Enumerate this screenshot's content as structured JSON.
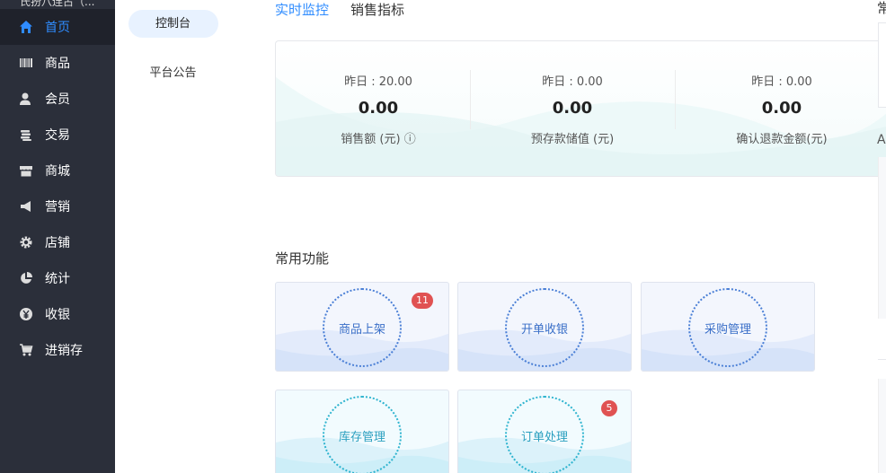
{
  "sidebar": {
    "store_name": "氏扮八连占（...",
    "items": [
      {
        "label": "首页",
        "icon": "home-icon",
        "active": true
      },
      {
        "label": "商品",
        "icon": "barcode-icon"
      },
      {
        "label": "会员",
        "icon": "member-icon"
      },
      {
        "label": "交易",
        "icon": "coins-icon"
      },
      {
        "label": "商城",
        "icon": "shop-icon"
      },
      {
        "label": "营销",
        "icon": "megaphone-icon"
      },
      {
        "label": "店铺",
        "icon": "gear-icon"
      },
      {
        "label": "统计",
        "icon": "pie-chart-icon"
      },
      {
        "label": "收银",
        "icon": "yen-icon"
      },
      {
        "label": "进销存",
        "icon": "cart-icon"
      }
    ],
    "accent": "#2f8cff"
  },
  "subnav": {
    "items": [
      {
        "label": "控制台",
        "active": true
      },
      {
        "label": "平台公告"
      }
    ]
  },
  "main": {
    "tabs": [
      {
        "label": "实时监控",
        "active": true
      },
      {
        "label": "销售指标"
      }
    ],
    "stats": [
      {
        "yesterday": "昨日 : 20.00",
        "value": "0.00",
        "label": "销售额 (元) ⓘ"
      },
      {
        "yesterday": "昨日 : 0.00",
        "value": "0.00",
        "label": "预存款储值 (元)"
      },
      {
        "yesterday": "昨日 : 0.00",
        "value": "0.00",
        "label": "确认退款金额(元)"
      }
    ],
    "right_panel": {
      "title_partial": "常",
      "label_partial": "A"
    },
    "section_title": "常用功能",
    "functions": [
      {
        "label": "商品上架",
        "badge": "11",
        "style": "blue"
      },
      {
        "label": "开单收银",
        "style": "blue"
      },
      {
        "label": "采购管理",
        "style": "blue"
      },
      {
        "label": "库存管理",
        "style": "cyan"
      },
      {
        "label": "订单处理",
        "badge": "5",
        "style": "cyan"
      }
    ]
  }
}
